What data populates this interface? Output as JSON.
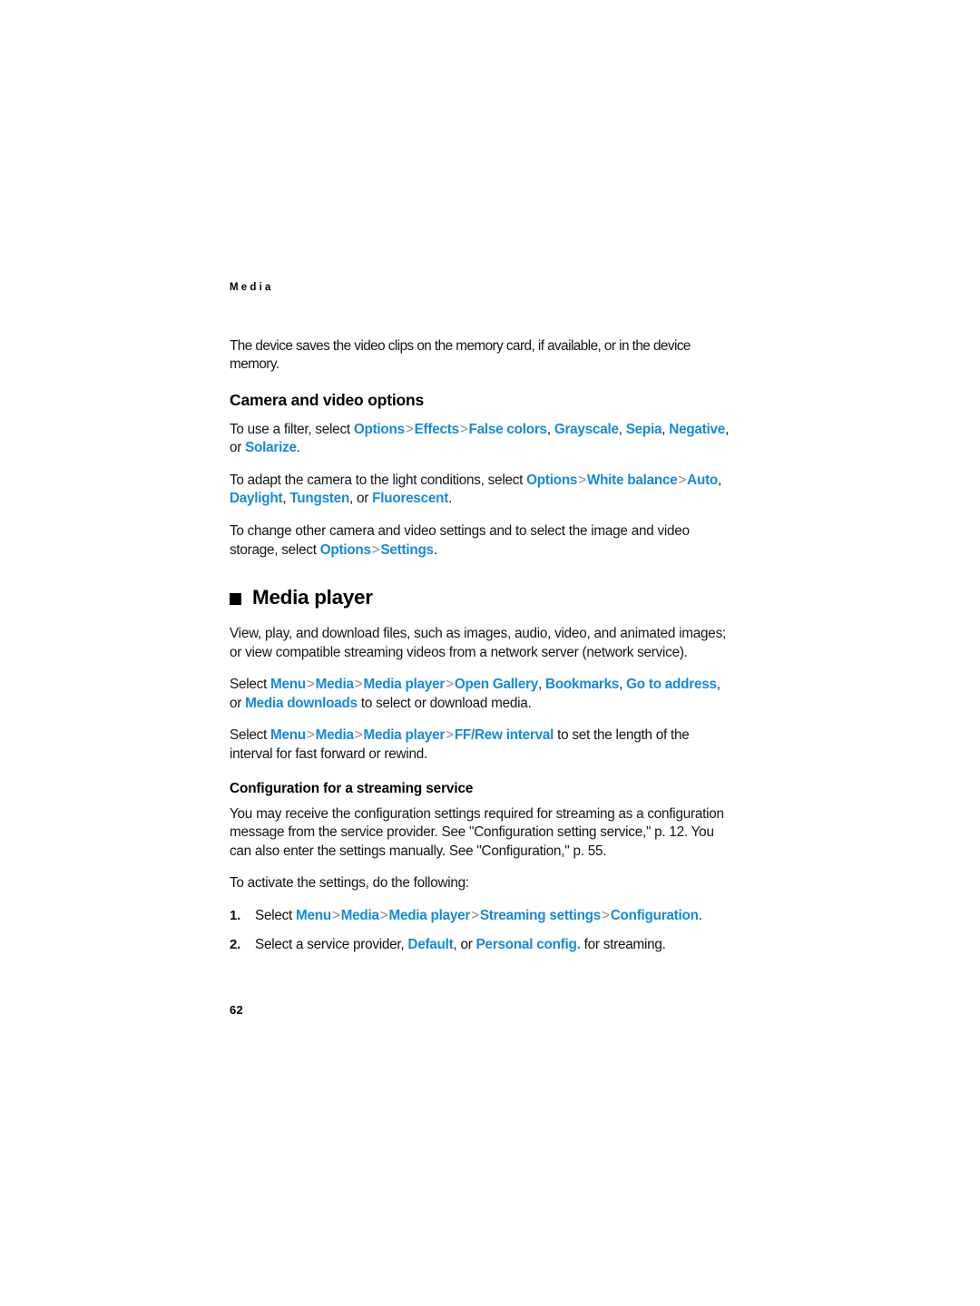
{
  "page": {
    "running_head": "Media",
    "folio": "62",
    "accent_color": "#1689DC",
    "separator_color": "#8a8a8a",
    "text_color": "#151515"
  },
  "intro": {
    "paragraph": "The device saves the video clips on the memory card, if available, or in the device memory."
  },
  "camera_section": {
    "heading": "Camera and video options",
    "filter_para": {
      "lead": "To use a filter, select ",
      "terms": [
        "Options",
        "Effects",
        "False colors",
        "Grayscale",
        "Sepia",
        "Negative",
        "Solarize"
      ],
      "sep": ">",
      "comma": ", ",
      "or": ", or ",
      "end": "."
    },
    "whitebalance_para": {
      "lead": "To adapt the camera to the light conditions, select ",
      "terms": [
        "Options",
        "White balance",
        "Auto",
        "Daylight",
        "Tungsten",
        "Fluorescent"
      ],
      "sep": ">",
      "comma": ", ",
      "or": ", or ",
      "end": "."
    },
    "settings_para": {
      "lead": "To change other camera and video settings and to select the image and video storage, select ",
      "terms": [
        "Options",
        "Settings"
      ],
      "sep": ">",
      "end": "."
    }
  },
  "media_player_section": {
    "bullet_icon": "black-square-bullet",
    "heading": "Media player",
    "description": "View, play, and download files, such as images, audio, video, and animated images; or view compatible streaming videos from a network server (network service).",
    "gallery_para": {
      "lead": "Select ",
      "terms": [
        "Menu",
        "Media",
        "Media player",
        "Open Gallery",
        "Bookmarks",
        "Go to address",
        "Media downloads"
      ],
      "sep": ">",
      "comma": ", ",
      "or": ", or ",
      "tail": " to select or download media."
    },
    "ffrew_para": {
      "lead": "Select ",
      "terms": [
        "Menu",
        "Media",
        "Media player",
        "FF/Rew interval"
      ],
      "sep": ">",
      "tail": " to set the length of the interval for fast forward or rewind."
    },
    "config_heading": "Configuration for a streaming service",
    "config_para": "You may receive the configuration settings required for streaming as a configuration message from the service provider. See \"Configuration setting service,\" p. 12. You can also enter the settings manually. See \"Configuration,\" p. 55.",
    "activate_lead": "To activate the settings, do the following:",
    "steps": [
      {
        "number": "1.",
        "lead": "Select ",
        "terms": [
          "Menu",
          "Media",
          "Media player",
          "Streaming settings",
          "Configuration"
        ],
        "sep": ">",
        "end": "."
      },
      {
        "number": "2.",
        "lead": "Select a service provider, ",
        "terms": [
          "Default",
          "Personal config."
        ],
        "comma": ", or ",
        "tail": " for streaming."
      }
    ]
  }
}
